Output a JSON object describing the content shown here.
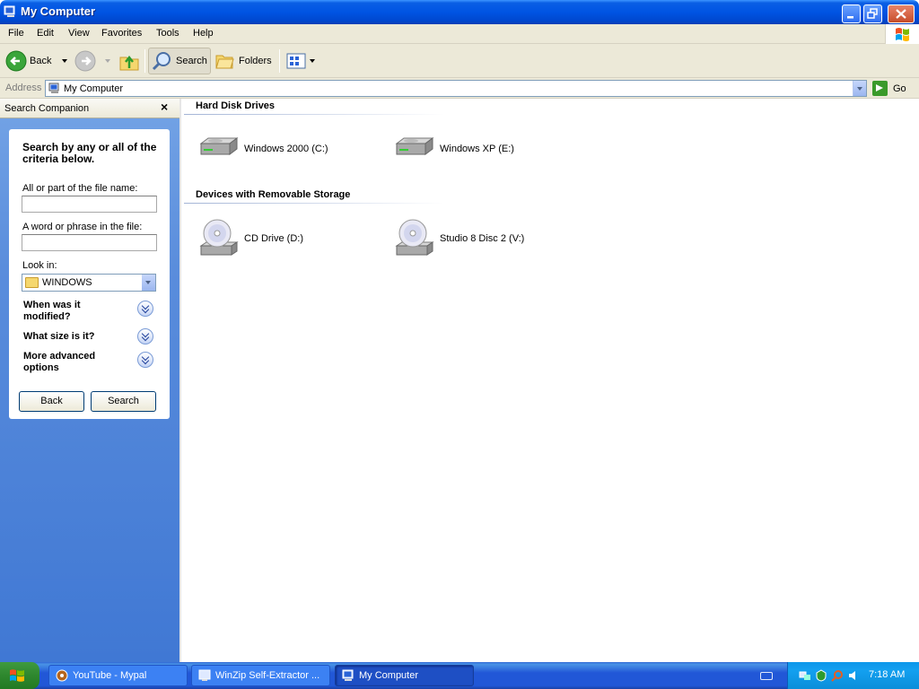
{
  "window": {
    "title": "My Computer"
  },
  "menu": [
    "File",
    "Edit",
    "View",
    "Favorites",
    "Tools",
    "Help"
  ],
  "toolbar": {
    "back": "Back",
    "search": "Search",
    "folders": "Folders"
  },
  "address": {
    "label": "Address",
    "value": "My Computer",
    "go": "Go"
  },
  "search_pane": {
    "title": "Search Companion",
    "close": "×",
    "heading": "Search by any or all of the criteria below.",
    "filename_label": "All or part of the file name:",
    "filename_value": "",
    "phrase_label": "A word or phrase in the file:",
    "phrase_value": "",
    "lookin_label": "Look in:",
    "lookin_value": "WINDOWS",
    "options": [
      "When was it modified?",
      "What size is it?",
      "More advanced options"
    ],
    "back_button": "Back",
    "search_button": "Search"
  },
  "groups": [
    {
      "title": "Hard Disk Drives",
      "items": [
        "Windows 2000 (C:)",
        "Windows XP (E:)"
      ]
    },
    {
      "title": "Devices with Removable Storage",
      "items": [
        "CD Drive (D:)",
        "Studio 8 Disc 2 (V:)"
      ]
    }
  ],
  "taskbar": {
    "tasks": [
      "YouTube - Mypal",
      "WinZip Self-Extractor ...",
      "My Computer"
    ],
    "active_task": "My Computer",
    "clock": "7:18 AM"
  }
}
